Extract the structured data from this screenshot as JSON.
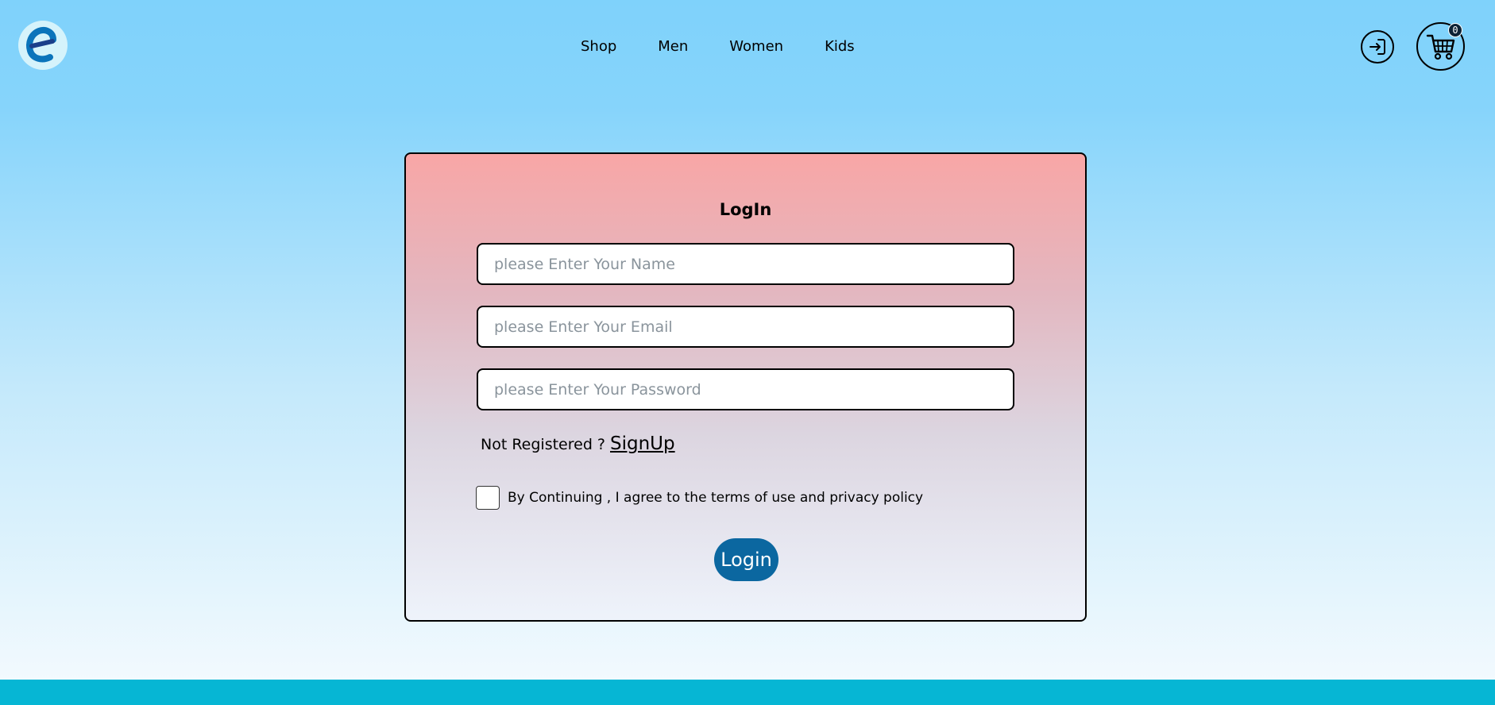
{
  "navbar": {
    "logo_icon": "e-logo-icon",
    "links": [
      {
        "label": "Shop"
      },
      {
        "label": "Men"
      },
      {
        "label": "Women"
      },
      {
        "label": "Kids"
      }
    ],
    "login_icon": "login-arrow-icon",
    "cart_icon": "shopping-cart-icon",
    "cart_count": "0"
  },
  "login_form": {
    "title": "LogIn",
    "name_placeholder": "please Enter Your Name",
    "email_placeholder": "please Enter Your Email",
    "password_placeholder": "please Enter Your Password",
    "not_registered_text": "Not Registered ?",
    "signup_label": "SignUp",
    "terms_text": "By Continuing , I agree to the terms of use and privacy policy",
    "submit_label": "Login"
  },
  "colors": {
    "accent": "#0b67a0",
    "footer": "#06b6d4",
    "logo_blue": "#0a74bb",
    "card_top": "#f8a6a6"
  }
}
